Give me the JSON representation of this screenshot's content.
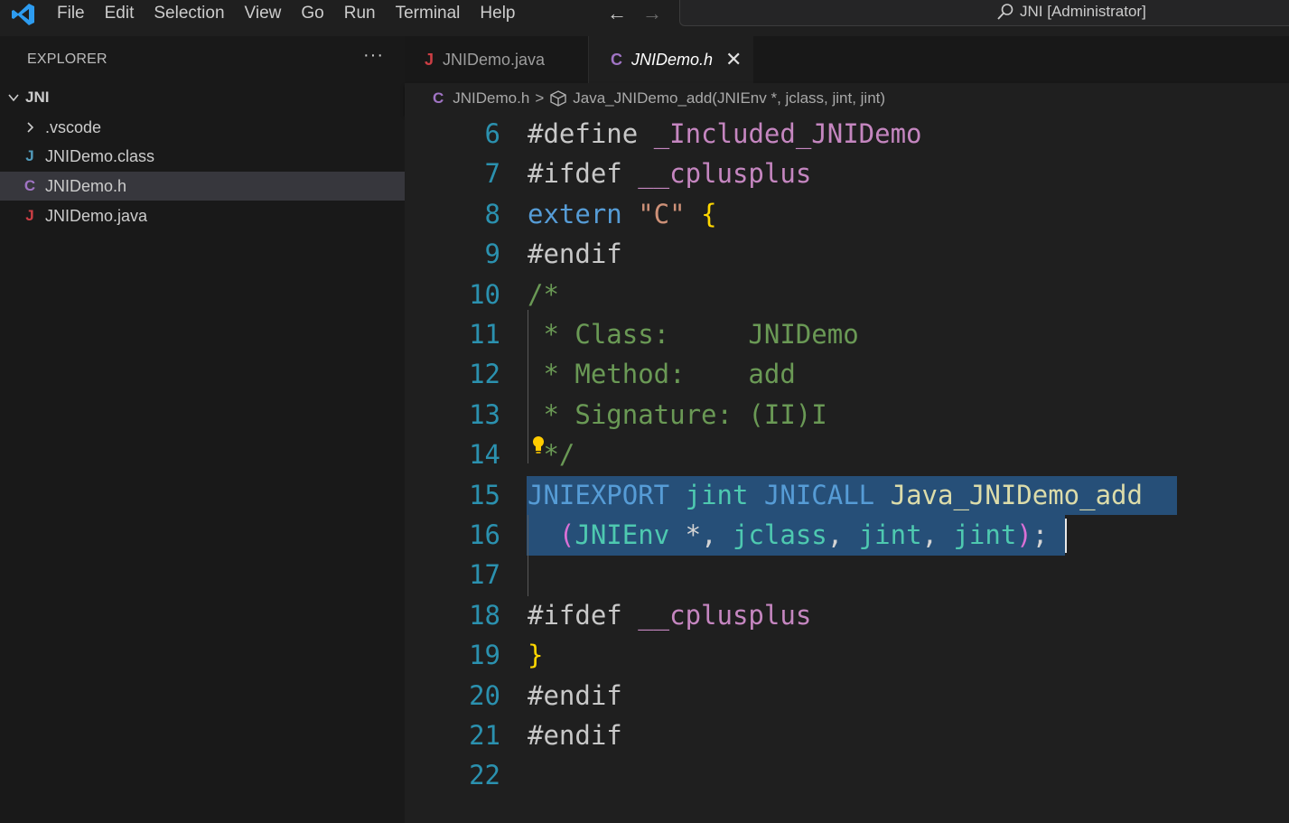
{
  "menu": [
    "File",
    "Edit",
    "Selection",
    "View",
    "Go",
    "Run",
    "Terminal",
    "Help"
  ],
  "command_center": {
    "text": "JNI [Administrator]"
  },
  "explorer": {
    "title": "EXPLORER",
    "more": "···",
    "root": "JNI",
    "items": [
      {
        "label": ".vscode",
        "kind": "folder"
      },
      {
        "label": "JNIDemo.class",
        "icon": "J",
        "icon_color": "#519aba"
      },
      {
        "label": "JNIDemo.h",
        "icon": "C",
        "icon_color": "#a074c4",
        "selected": true
      },
      {
        "label": "JNIDemo.java",
        "icon": "J",
        "icon_color": "#cc3e44"
      }
    ]
  },
  "tabs": [
    {
      "label": "JNIDemo.java",
      "icon": "J",
      "icon_color": "#cc3e44",
      "active": false
    },
    {
      "label": "JNIDemo.h",
      "icon": "C",
      "icon_color": "#a074c4",
      "active": true,
      "close": "✕"
    }
  ],
  "breadcrumb": {
    "icon": "C",
    "file": "JNIDemo.h",
    "sep": ">",
    "symbol": "Java_JNIDemo_add(JNIEnv *, jclass, jint, jint)"
  },
  "editor": {
    "lines": [
      {
        "n": "6",
        "tokens": [
          [
            "k-pre",
            "#define "
          ],
          [
            "k-macro",
            "_Included_JNIDemo"
          ]
        ]
      },
      {
        "n": "7",
        "tokens": [
          [
            "k-pre",
            "#ifdef "
          ],
          [
            "k-macro",
            "__cplusplus"
          ]
        ]
      },
      {
        "n": "8",
        "tokens": [
          [
            "k-kw",
            "extern "
          ],
          [
            "k-str",
            "\"C\" "
          ],
          [
            "k-brace",
            "{"
          ]
        ]
      },
      {
        "n": "9",
        "tokens": [
          [
            "k-pre",
            "#endif"
          ]
        ]
      },
      {
        "n": "10",
        "tokens": [
          [
            "k-com",
            "/*"
          ]
        ]
      },
      {
        "n": "11",
        "tokens": [
          [
            "k-com",
            " * Class:     JNIDemo"
          ]
        ]
      },
      {
        "n": "12",
        "tokens": [
          [
            "k-com",
            " * Method:    add"
          ]
        ]
      },
      {
        "n": "13",
        "tokens": [
          [
            "k-com",
            " * Signature: (II)I"
          ]
        ]
      },
      {
        "n": "14",
        "tokens": [
          [
            "k-com",
            " */"
          ]
        ]
      },
      {
        "n": "15",
        "tokens": [
          [
            "k-kw",
            "JNIEXPORT "
          ],
          [
            "k-type",
            "jint "
          ],
          [
            "k-kw",
            "JNICALL "
          ],
          [
            "k-fn",
            "Java_JNIDemo_add"
          ]
        ]
      },
      {
        "n": "16",
        "tokens": [
          [
            "k-paren",
            "  ("
          ],
          [
            "k-type",
            "JNIEnv "
          ],
          [
            "k-plain",
            "*, "
          ],
          [
            "k-type",
            "jclass"
          ],
          [
            "k-plain",
            ", "
          ],
          [
            "k-type",
            "jint"
          ],
          [
            "k-plain",
            ", "
          ],
          [
            "k-type",
            "jint"
          ],
          [
            "k-paren",
            ")"
          ],
          [
            "k-plain",
            ";"
          ]
        ]
      },
      {
        "n": "17",
        "tokens": []
      },
      {
        "n": "18",
        "tokens": [
          [
            "k-pre",
            "#ifdef "
          ],
          [
            "k-macro",
            "__cplusplus"
          ]
        ]
      },
      {
        "n": "19",
        "tokens": [
          [
            "k-brace",
            "}"
          ]
        ]
      },
      {
        "n": "20",
        "tokens": [
          [
            "k-pre",
            "#endif"
          ]
        ]
      },
      {
        "n": "21",
        "tokens": [
          [
            "k-pre",
            "#endif"
          ]
        ]
      },
      {
        "n": "22",
        "tokens": []
      }
    ],
    "selected_lines": [
      "15",
      "16"
    ]
  },
  "colors": {
    "accent": "#0078d4",
    "selection": "#264f78",
    "line_number": "#2b91af"
  }
}
